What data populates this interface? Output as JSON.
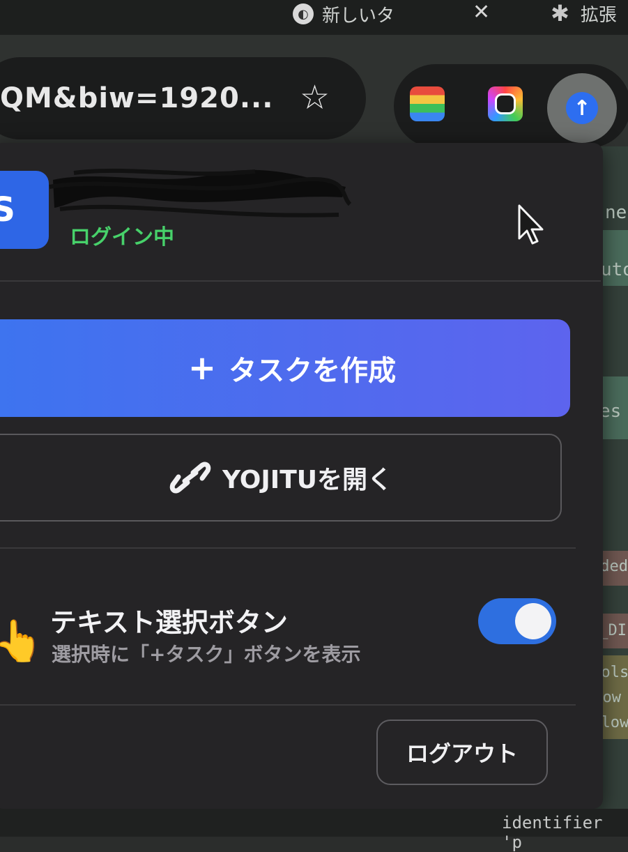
{
  "browser": {
    "tab_new_title": "新しいタ",
    "tab_close_glyph": "✕",
    "tab_extensions_label": "拡張",
    "address_url": "QM&biw=1920...",
    "bookmark_glyph": "☆",
    "active_extension_glyph": "↑"
  },
  "popup": {
    "user": {
      "avatar_letter": "S",
      "status": "ログイン中"
    },
    "actions": {
      "create_task_plus": "+",
      "create_task_label": "タスクを作成",
      "open_yojitu_label": "YOJITUを開く"
    },
    "settings": {
      "text_select_title": "テキスト選択ボタン",
      "text_select_desc": "選択時に「+タスク」ボタンを表示",
      "text_select_enabled": true
    },
    "logout_label": "ログアウト"
  },
  "background_page": {
    "lines": [
      "ne",
      "uto",
      "es",
      "nded",
      "T_DI",
      "Tools",
      "llow",
      "allow"
    ],
    "bottom_text": "identifier 'p"
  },
  "colors": {
    "accent_blue": "#3d74ef",
    "status_green": "#47d16a",
    "toggle_on": "#2e6fe0",
    "popup_bg": "#252426"
  }
}
